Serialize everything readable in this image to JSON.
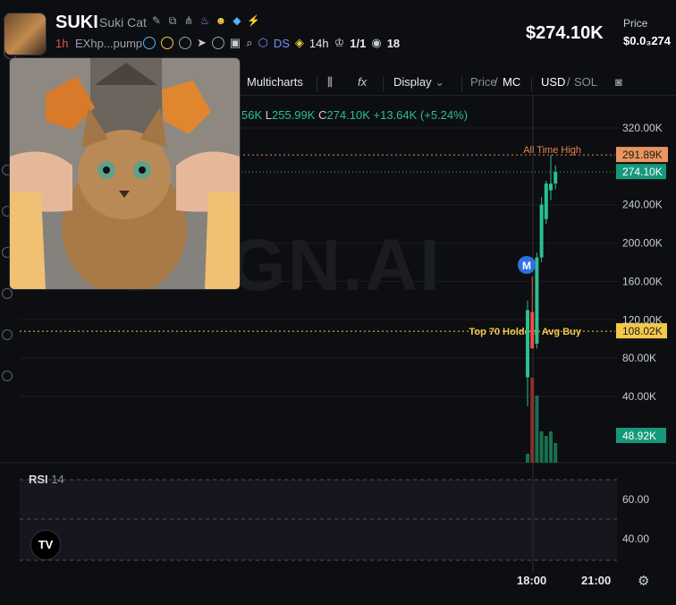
{
  "token": {
    "symbol": "SUKI",
    "name": "Suki Cat",
    "age": "1h",
    "address": "EXhp...pump",
    "ds_label": "DS",
    "time_label": "14h",
    "ratio": "1/1",
    "views": "18"
  },
  "header": {
    "price_big": "$274.10K",
    "price_label": "Price",
    "price_small": "$0.0₃274"
  },
  "toolbar": {
    "multicharts": "Multicharts",
    "fx": "fx",
    "display": "Display",
    "price": "Price",
    "slash": "/",
    "mc": "MC",
    "usd": "USD",
    "sol": "SOL"
  },
  "ohlc": {
    "partial": "56K",
    "l_key": "L",
    "l_val": "255.99K",
    "c_key": "C",
    "c_val": "274.10K",
    "change": "+13.64K (+5.24%)"
  },
  "watermark": "GMGN.AI",
  "chart_data": {
    "type": "candlestick",
    "y_ticks": [
      "320.00K",
      "240.00K",
      "200.00K",
      "160.00K",
      "120.00K",
      "80.00K",
      "40.00K"
    ],
    "y_tick_values": [
      320,
      240,
      200,
      160,
      120,
      80,
      40
    ],
    "x_ticks": [
      "18:00",
      "21:00"
    ],
    "unit": "K USD",
    "candles": [
      {
        "open": 130,
        "high": 140,
        "low": 30,
        "close": 60,
        "color": "#2bbf8f"
      },
      {
        "open": 128,
        "high": 165,
        "low": 95,
        "close": 90,
        "color": "#f04a4a"
      },
      {
        "open": 95,
        "high": 190,
        "low": 90,
        "close": 185,
        "color": "#2bbf8f"
      },
      {
        "open": 185,
        "high": 248,
        "low": 180,
        "close": 240,
        "color": "#2bbf8f"
      },
      {
        "open": 225,
        "high": 265,
        "low": 220,
        "close": 262,
        "color": "#2bbf8f"
      },
      {
        "open": 262,
        "high": 292,
        "low": 245,
        "close": 255,
        "color": "#2bbf8f"
      },
      {
        "open": 262,
        "high": 281,
        "low": 256,
        "close": 274.1,
        "color": "#2bbf8f"
      }
    ],
    "volume": [
      0.1,
      0.95,
      0.75,
      0.35,
      0.3,
      0.35,
      0.22
    ],
    "annotations": {
      "ath_label": "All Time High",
      "ath_value_label": "291.89K",
      "ath_value": 291.89,
      "current_value_label": "274.10K",
      "current_value": 274.1,
      "avg_buy_label": "Top 70 Holders Avg Buy",
      "avg_buy_value_label": "108.02K",
      "avg_buy_value": 108.02,
      "volume_value_label": "48.92K",
      "marker": "M"
    },
    "rsi": {
      "label": "RSI",
      "period": "14",
      "ticks": [
        "60.00",
        "40.00"
      ]
    },
    "colors": {
      "up": "#2bbf8f",
      "down": "#f04a4a",
      "ath": "#e8824f",
      "avg": "#f2c94c"
    }
  }
}
